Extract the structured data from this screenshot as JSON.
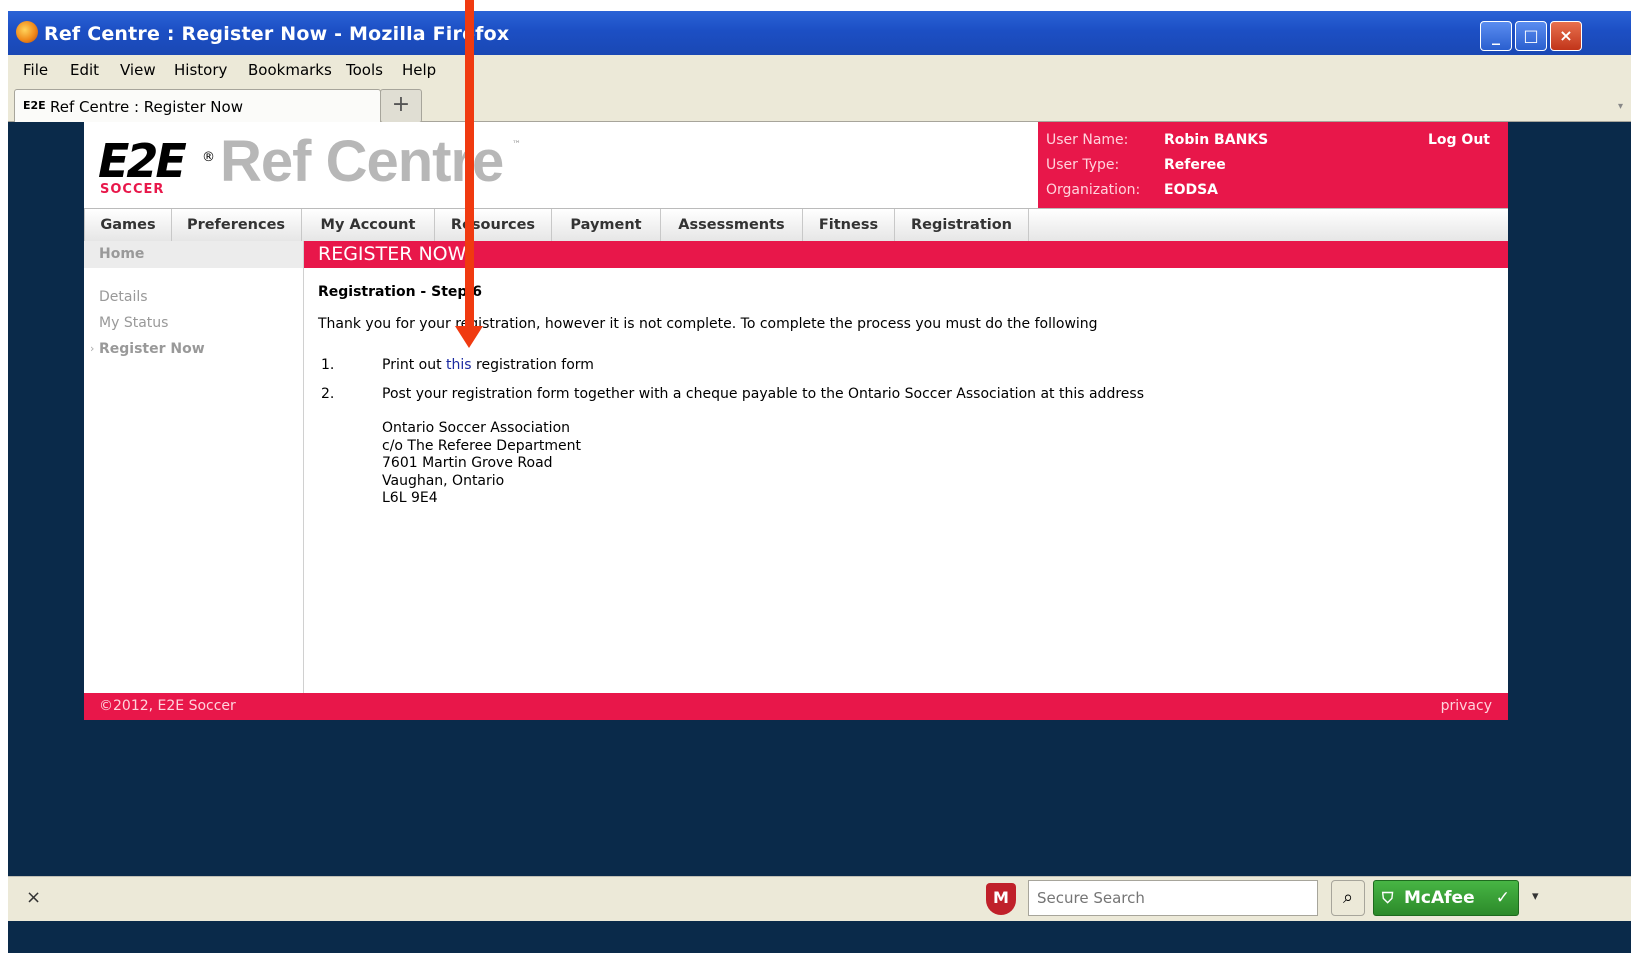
{
  "browser": {
    "window_title": "Ref Centre : Register Now - Mozilla Firefox",
    "menu": [
      "File",
      "Edit",
      "View",
      "History",
      "Bookmarks",
      "Tools",
      "Help"
    ],
    "tab_title": "Ref Centre : Register Now",
    "tab_favicon": "E2E",
    "new_tab": "+",
    "status_close": "×",
    "search_placeholder": "Secure Search",
    "search_icon": "search-icon",
    "mcafee_label": "McAfee",
    "dropdown_glyph": "▾"
  },
  "site": {
    "logo_text": "E2E",
    "logo_sub": "SOCCER",
    "logo_reg": "®",
    "brand": "Ref Centre",
    "brand_tm": "™",
    "user": {
      "name_label": "User Name:",
      "name_value": "Robin BANKS",
      "type_label": "User Type:",
      "type_value": "Referee",
      "org_label": "Organization:",
      "org_value": "EODSA",
      "logout": "Log Out"
    },
    "nav": [
      "Games",
      "Preferences",
      "My Account",
      "Resources",
      "Payment",
      "Assessments",
      "Fitness",
      "Registration"
    ],
    "sidebar": {
      "home": "Home",
      "items": [
        "Details",
        "My Status",
        "Register Now"
      ]
    },
    "content": {
      "heading": "REGISTER NOW",
      "step_title": "Registration - Step 6",
      "message": "Thank you for your registration, however it is not complete. To complete the process you must do the following",
      "list": [
        {
          "num": "1.",
          "pre": "Print out ",
          "link": "this",
          "post": " registration form"
        },
        {
          "num": "2.",
          "text": "Post your registration form together with a cheque payable to the Ontario Soccer Association at this address"
        }
      ],
      "address": [
        "Ontario Soccer Association",
        "c/o The Referee Department",
        "7601 Martin Grove Road",
        "Vaughan, Ontario",
        "L6L 9E4"
      ]
    },
    "footer": {
      "copyright": "©2012, E2E Soccer",
      "privacy": "privacy"
    }
  },
  "colors": {
    "accent": "#e8174a",
    "annotation_arrow": "#f03a10",
    "window_bg": "#0a2a4a"
  }
}
